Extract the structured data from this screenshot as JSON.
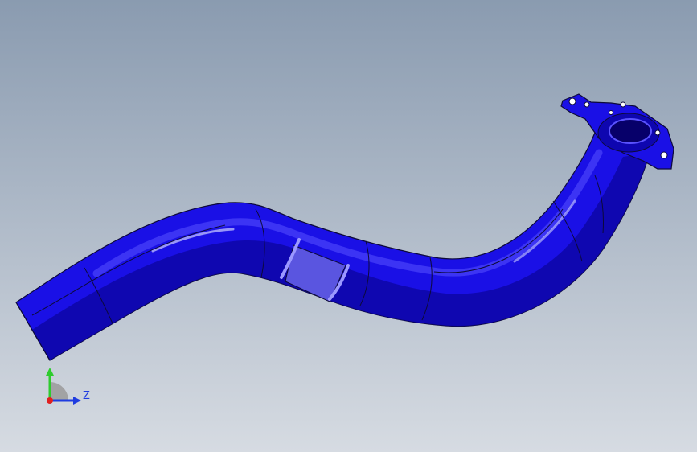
{
  "viewport": {
    "background_top": "#8a9bb0",
    "background_bottom": "#d6dbe2"
  },
  "model": {
    "color": "#1a10e6",
    "color_dark": "#0a0080",
    "color_light": "#6f68ff",
    "edge_color": "#0d0a3a"
  },
  "triad": {
    "axis_z_label": "Z",
    "y_color": "#2ecc2e",
    "z_color": "#1f3ce0",
    "x_color": "#e02020"
  }
}
